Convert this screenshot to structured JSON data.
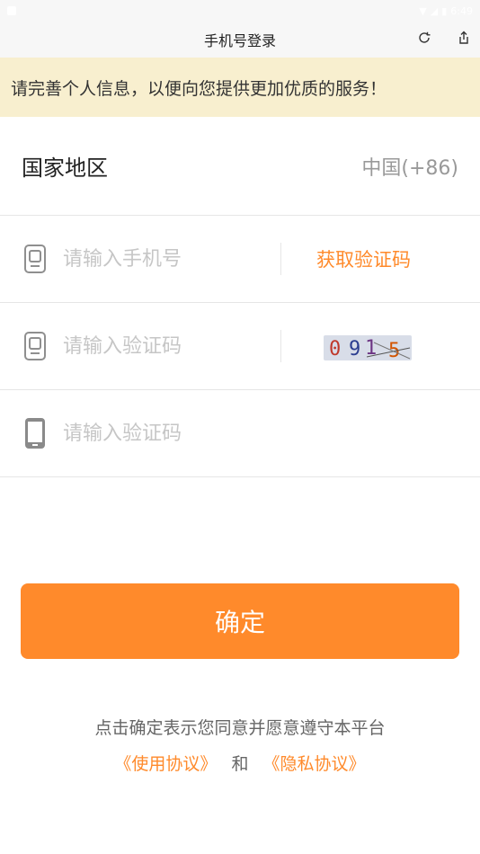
{
  "status_bar": {
    "time": "6:49"
  },
  "header": {
    "title": "手机号登录",
    "refresh_icon": "refresh-icon",
    "share_icon": "share-icon"
  },
  "notice": {
    "text": "请完善个人信息，以便向您提供更加优质的服务！"
  },
  "region": {
    "label": "国家地区",
    "value": "中国(+86)"
  },
  "phone_field": {
    "placeholder": "请输入手机号",
    "value": "",
    "icon": "phone-outline-icon",
    "action_label": "获取验证码"
  },
  "captcha_field": {
    "placeholder": "请输入验证码",
    "value": "",
    "icon": "phone-outline-icon",
    "captcha_text": "0915"
  },
  "sms_field": {
    "placeholder": "请输入验证码",
    "value": "",
    "icon": "phone-filled-icon"
  },
  "confirm": {
    "label": "确定"
  },
  "agreement": {
    "text": "点击确定表示您同意并愿意遵守本平台",
    "terms_link": "《使用协议》",
    "and_text": "和",
    "privacy_link": "《隐私协议》"
  },
  "colors": {
    "accent": "#ff8a2b",
    "notice_bg": "#f8efcf",
    "placeholder": "#c6c6c6"
  }
}
